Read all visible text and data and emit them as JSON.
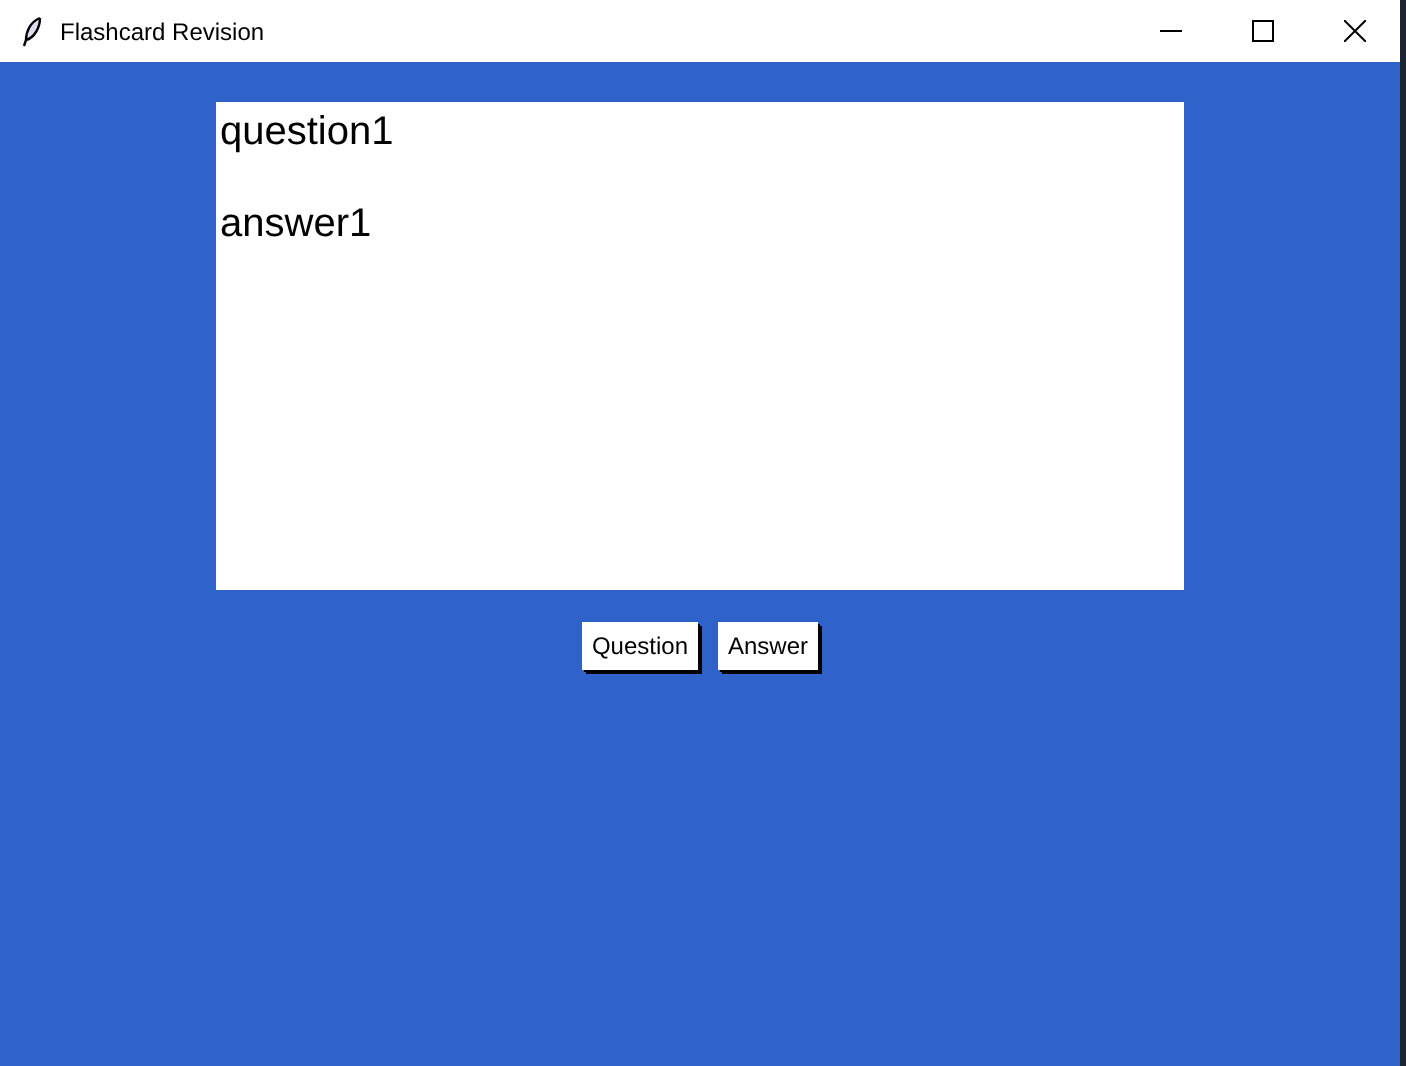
{
  "window": {
    "title": "Flashcard Revision"
  },
  "text_area": {
    "lines": [
      "question1",
      "answer1"
    ]
  },
  "buttons": [
    "Question",
    "Answer"
  ]
}
